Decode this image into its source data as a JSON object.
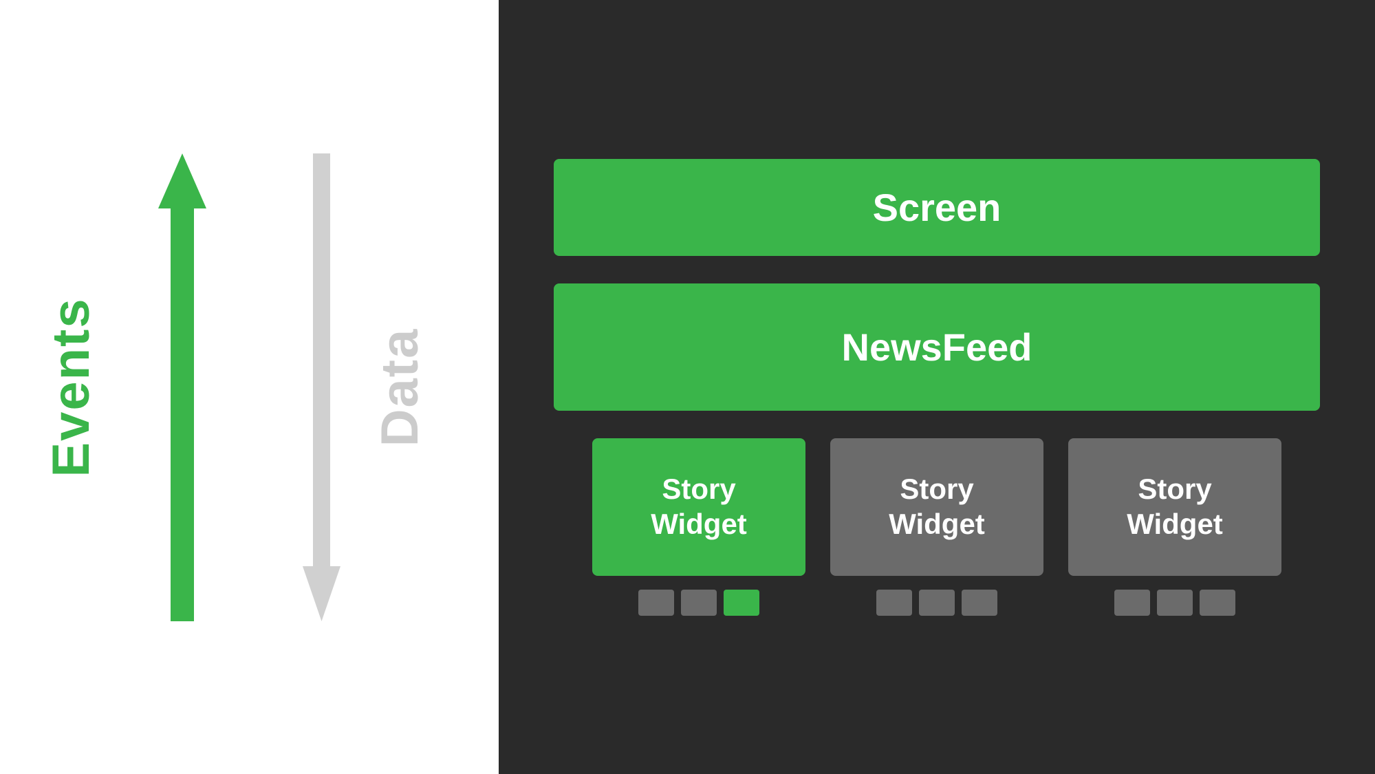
{
  "left": {
    "events_label": "Events",
    "data_label": "Data"
  },
  "right": {
    "screen_label": "Screen",
    "newsfeed_label": "NewsFeed",
    "story_widgets": [
      {
        "label": "Story\nWidget",
        "type": "green",
        "indicators": [
          "gray",
          "gray",
          "green"
        ]
      },
      {
        "label": "Story\nWidget",
        "type": "gray",
        "indicators": [
          "gray",
          "gray",
          "gray"
        ]
      },
      {
        "label": "Story\nWidget",
        "type": "gray",
        "indicators": [
          "gray",
          "gray",
          "gray"
        ]
      }
    ]
  },
  "colors": {
    "green": "#3ab54a",
    "gray_dark": "#6b6b6b",
    "gray_light": "#cccccc",
    "bg_left": "#ffffff",
    "bg_right": "#2a2a2a",
    "text_white": "#ffffff"
  }
}
